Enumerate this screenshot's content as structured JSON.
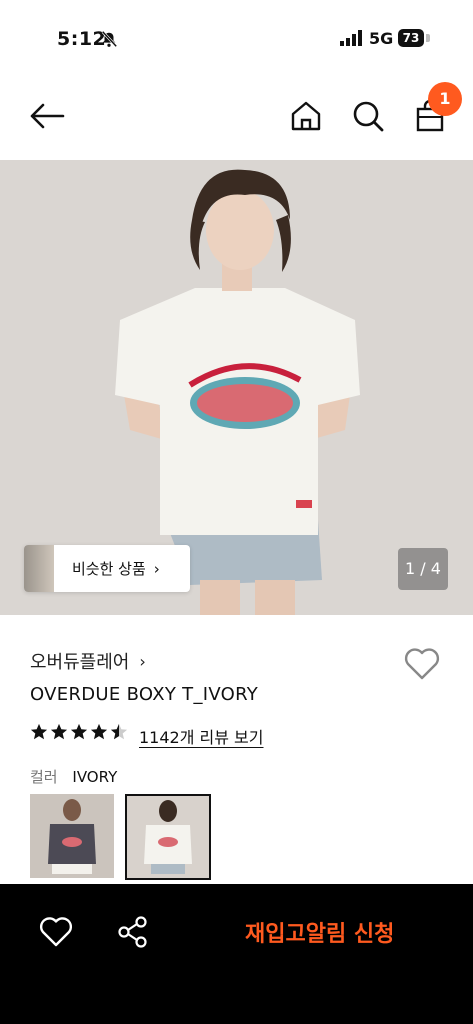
{
  "status": {
    "time": "5:12",
    "network": "5G",
    "battery": "73"
  },
  "nav": {
    "cart_count": "1"
  },
  "gallery": {
    "similar_label": "비슷한 상품",
    "counter": "1 / 4"
  },
  "product": {
    "brand": "오버듀플레어",
    "name": "OVERDUE BOXY T_IVORY",
    "rating": 4.5,
    "review_link": "1142개 리뷰 보기",
    "color_label": "컬러",
    "color_value": "IVORY"
  },
  "bottom": {
    "restock_label": "재입고알림 신청"
  },
  "colors": {
    "accent": "#ff5a1f",
    "bottom_bar": "#000000"
  }
}
